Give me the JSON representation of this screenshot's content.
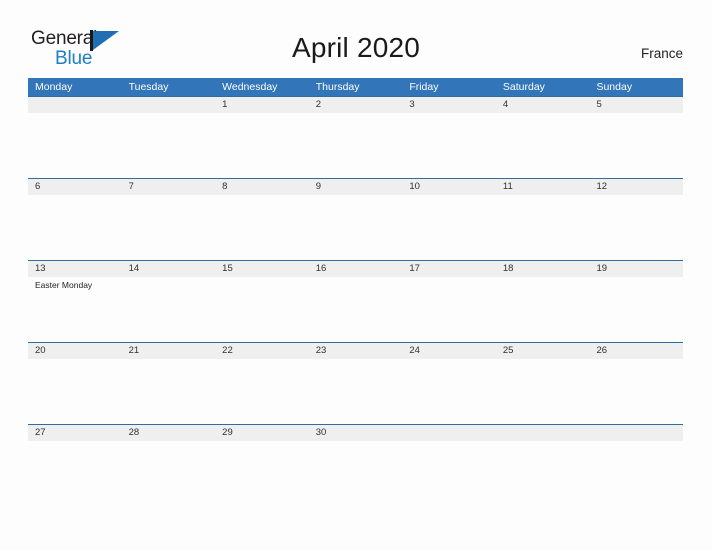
{
  "brand": {
    "name_part1": "General",
    "name_part2": "Blue",
    "logo_icon": "flag-triangle-icon"
  },
  "header": {
    "title": "April 2020",
    "country": "France"
  },
  "colors": {
    "header_blue": "#3275b8",
    "row_border_blue": "#2e6da4",
    "date_strip_gray": "#efefef",
    "logo_blue": "#1d7fc3",
    "page_background": "#fdfdfd",
    "text_dark": "#232323"
  },
  "calendar": {
    "month": "April",
    "year": "2020",
    "weekday_headers": [
      "Monday",
      "Tuesday",
      "Wednesday",
      "Thursday",
      "Friday",
      "Saturday",
      "Sunday"
    ],
    "weeks": [
      {
        "days": [
          {
            "date": "",
            "events": []
          },
          {
            "date": "",
            "events": []
          },
          {
            "date": "1",
            "events": []
          },
          {
            "date": "2",
            "events": []
          },
          {
            "date": "3",
            "events": []
          },
          {
            "date": "4",
            "events": []
          },
          {
            "date": "5",
            "events": []
          }
        ]
      },
      {
        "days": [
          {
            "date": "6",
            "events": []
          },
          {
            "date": "7",
            "events": []
          },
          {
            "date": "8",
            "events": []
          },
          {
            "date": "9",
            "events": []
          },
          {
            "date": "10",
            "events": []
          },
          {
            "date": "11",
            "events": []
          },
          {
            "date": "12",
            "events": []
          }
        ]
      },
      {
        "days": [
          {
            "date": "13",
            "events": [
              "Easter Monday"
            ]
          },
          {
            "date": "14",
            "events": []
          },
          {
            "date": "15",
            "events": []
          },
          {
            "date": "16",
            "events": []
          },
          {
            "date": "17",
            "events": []
          },
          {
            "date": "18",
            "events": []
          },
          {
            "date": "19",
            "events": []
          }
        ]
      },
      {
        "days": [
          {
            "date": "20",
            "events": []
          },
          {
            "date": "21",
            "events": []
          },
          {
            "date": "22",
            "events": []
          },
          {
            "date": "23",
            "events": []
          },
          {
            "date": "24",
            "events": []
          },
          {
            "date": "25",
            "events": []
          },
          {
            "date": "26",
            "events": []
          }
        ]
      },
      {
        "days": [
          {
            "date": "27",
            "events": []
          },
          {
            "date": "28",
            "events": []
          },
          {
            "date": "29",
            "events": []
          },
          {
            "date": "30",
            "events": []
          },
          {
            "date": "",
            "events": []
          },
          {
            "date": "",
            "events": []
          },
          {
            "date": "",
            "events": []
          }
        ]
      }
    ]
  }
}
